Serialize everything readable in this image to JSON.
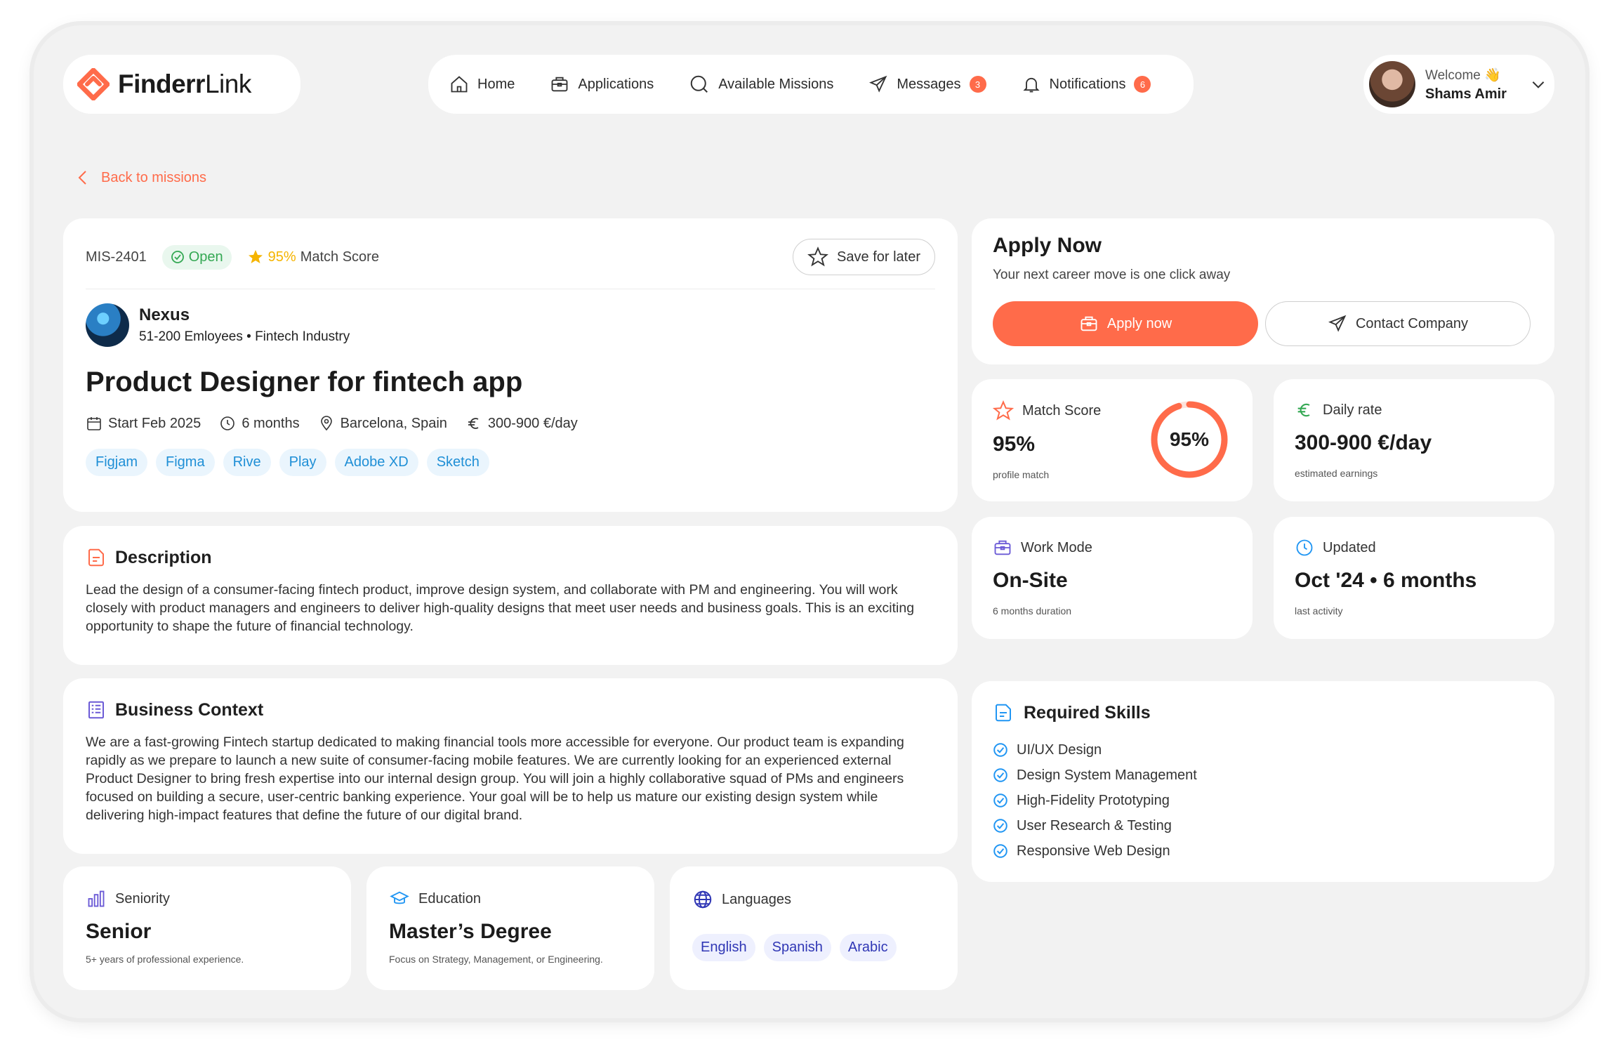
{
  "brand": {
    "name_bold": "Finderr",
    "name_light": "Link",
    "accent": "#ff6b4a"
  },
  "nav": {
    "items": [
      {
        "label": "Home",
        "icon": "home-icon"
      },
      {
        "label": "Applications",
        "icon": "briefcase-icon"
      },
      {
        "label": "Available Missions",
        "icon": "search-icon"
      },
      {
        "label": "Messages",
        "icon": "send-icon",
        "badge": "3"
      },
      {
        "label": "Notifications",
        "icon": "bell-icon",
        "badge": "6"
      }
    ]
  },
  "user": {
    "welcome": "Welcome 👋",
    "name": "Shams Amir"
  },
  "back_label": "Back to missions",
  "mission": {
    "id": "MIS-2401",
    "status": "Open",
    "match_pct": "95%",
    "match_label": "Match Score",
    "save_label": "Save for later",
    "company": {
      "name": "Nexus",
      "meta": "51-200 Emloyees • Fintech Industry"
    },
    "title": "Product Designer for fintech app",
    "start": "Start Feb 2025",
    "duration": "6 months",
    "location": "Barcelona, Spain",
    "rate": "300-900 €/day",
    "tags": [
      "Figjam",
      "Figma",
      "Rive",
      "Play",
      "Adobe XD",
      "Sketch"
    ]
  },
  "description": {
    "heading": "Description",
    "text": "Lead the design of a consumer-facing fintech product, improve design system, and collaborate with PM and engineering. You will work closely with product managers and engineers to deliver high-quality designs that meet user needs and business goals. This is an exciting opportunity to shape the future of financial technology."
  },
  "business": {
    "heading": "Business Context",
    "text": "We are a fast-growing Fintech startup dedicated to making financial tools more accessible for everyone. Our product team is expanding rapidly as we prepare to launch a new suite of consumer-facing mobile features. We are currently looking for an experienced external Product Designer to bring fresh expertise into our internal design group. You will join a highly collaborative squad of PMs and engineers focused on building a secure, user-centric banking experience. Your goal will be to help us mature our existing design system while delivering high-impact features that define the future of our digital brand."
  },
  "seniority": {
    "label": "Seniority",
    "value": "Senior",
    "sub": "5+ years of professional experience."
  },
  "education": {
    "label": "Education",
    "value": "Master’s Degree",
    "sub": "Focus on Strategy, Management, or Engineering."
  },
  "languages": {
    "label": "Languages",
    "items": [
      "English",
      "Spanish",
      "Arabic"
    ]
  },
  "apply": {
    "title": "Apply Now",
    "subtitle": "Your next career move is one click away",
    "apply_label": "Apply now",
    "contact_label": "Contact Company"
  },
  "stats": {
    "match": {
      "label": "Match Score",
      "value": "95%",
      "sub": "profile match",
      "ring_value": "95%",
      "ring_fraction": 0.95
    },
    "rate": {
      "label": "Daily rate",
      "value": "300-900 €/day",
      "sub": "estimated earnings"
    },
    "mode": {
      "label": "Work Mode",
      "value": "On-Site",
      "sub": "6 months duration"
    },
    "updated": {
      "label": "Updated",
      "value": "Oct '24 • 6 months",
      "sub": "last activity"
    }
  },
  "skills": {
    "heading": "Required Skills",
    "items": [
      "UI/UX Design",
      "Design System Management",
      "High-Fidelity Prototyping",
      "User Research & Testing",
      "Responsive Web Design"
    ]
  }
}
